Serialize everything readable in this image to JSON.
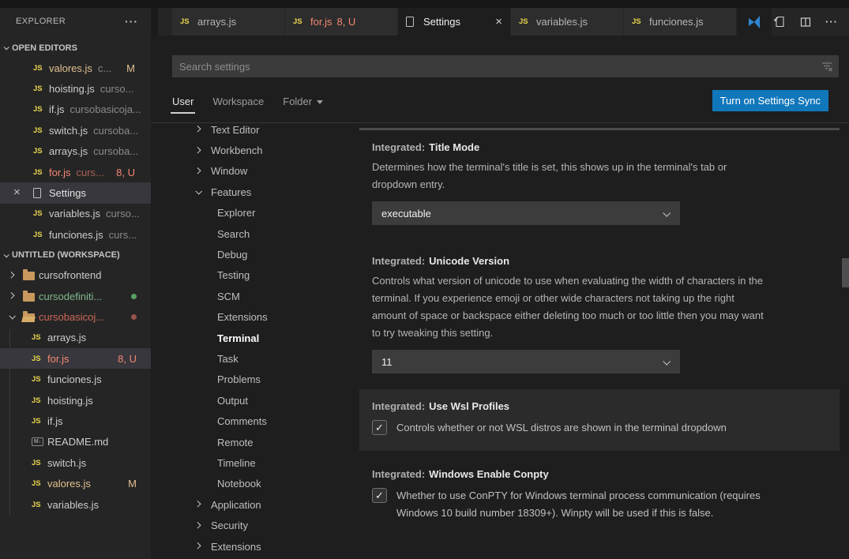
{
  "explorer": {
    "title": "EXPLORER",
    "open_editors": {
      "header": "OPEN EDITORS",
      "items": [
        {
          "icon": "js",
          "label": "valores.js",
          "suffix": "c...",
          "badge": "M",
          "badge_color": "mod",
          "color": "c-mod"
        },
        {
          "icon": "js",
          "label": "hoisting.js",
          "suffix": "curso..."
        },
        {
          "icon": "js",
          "label": "if.js",
          "suffix": "cursobasicoja..."
        },
        {
          "icon": "js",
          "label": "switch.js",
          "suffix": "cursoba..."
        },
        {
          "icon": "js",
          "label": "arrays.js",
          "suffix": "cursoba..."
        },
        {
          "icon": "js",
          "label": "for.js",
          "suffix": "curs...",
          "badge": "8, U",
          "badge_color": "err",
          "color": "c-err"
        },
        {
          "icon": "file",
          "label": "Settings",
          "selected": true,
          "close": "×"
        },
        {
          "icon": "js",
          "label": "variables.js",
          "suffix": "curso..."
        },
        {
          "icon": "js",
          "label": "funciones.js",
          "suffix": "curs..."
        }
      ]
    },
    "workspace": {
      "header": "UNTITLED (WORKSPACE)",
      "items": [
        {
          "icon": "folder",
          "chevron": "right",
          "label": "cursofrontend"
        },
        {
          "icon": "folder",
          "chevron": "right",
          "label": "cursodefiniti...",
          "color": "c-green",
          "dot": "green"
        },
        {
          "icon": "folder-open",
          "chevron": "down",
          "label": "cursobasicoj...",
          "color": "c-red",
          "dot": "red"
        },
        {
          "icon": "js",
          "label": "arrays.js",
          "child": true
        },
        {
          "icon": "js",
          "label": "for.js",
          "badge": "8, U",
          "badge_color": "err",
          "color": "c-err",
          "selected": true,
          "child": true
        },
        {
          "icon": "js",
          "label": "funciones.js",
          "child": true
        },
        {
          "icon": "js",
          "label": "hoisting.js",
          "child": true
        },
        {
          "icon": "js",
          "label": "if.js",
          "child": true
        },
        {
          "icon": "md",
          "label": "README.md",
          "child": true
        },
        {
          "icon": "js",
          "label": "switch.js",
          "child": true
        },
        {
          "icon": "js",
          "label": "valores.js",
          "badge": "M",
          "badge_color": "mod",
          "color": "c-mod",
          "child": true
        },
        {
          "icon": "js",
          "label": "variables.js",
          "child": true
        }
      ]
    }
  },
  "tabbar": {
    "tabs": [
      {
        "icon": "js",
        "label": "arrays.js"
      },
      {
        "icon": "js",
        "label": "for.js",
        "badge": "8, U",
        "err": true
      },
      {
        "icon": "file",
        "label": "Settings",
        "active": true,
        "close": "×"
      },
      {
        "icon": "js",
        "label": "variables.js"
      },
      {
        "icon": "js",
        "label": "funciones.js"
      }
    ],
    "overflow_icon": "blue-file",
    "actions": [
      "open-settings-json",
      "split-editor",
      "more"
    ]
  },
  "settings": {
    "search": {
      "placeholder": "Search settings"
    },
    "scopes": [
      {
        "label": "User",
        "active": true
      },
      {
        "label": "Workspace"
      },
      {
        "label": "Folder",
        "dropdown": true
      }
    ],
    "sync_button": "Turn on Settings Sync",
    "toc": [
      {
        "label": "Text Editor",
        "chevron": "right"
      },
      {
        "label": "Workbench",
        "chevron": "right"
      },
      {
        "label": "Window",
        "chevron": "right"
      },
      {
        "label": "Features",
        "chevron": "down"
      },
      {
        "label": "Explorer",
        "child": true
      },
      {
        "label": "Search",
        "child": true
      },
      {
        "label": "Debug",
        "child": true
      },
      {
        "label": "Testing",
        "child": true
      },
      {
        "label": "SCM",
        "child": true
      },
      {
        "label": "Extensions",
        "child": true
      },
      {
        "label": "Terminal",
        "child": true,
        "active": true
      },
      {
        "label": "Task",
        "child": true
      },
      {
        "label": "Problems",
        "child": true
      },
      {
        "label": "Output",
        "child": true
      },
      {
        "label": "Comments",
        "child": true
      },
      {
        "label": "Remote",
        "child": true
      },
      {
        "label": "Timeline",
        "child": true
      },
      {
        "label": "Notebook",
        "child": true
      },
      {
        "label": "Application",
        "chevron": "right"
      },
      {
        "label": "Security",
        "chevron": "right"
      },
      {
        "label": "Extensions",
        "chevron": "right"
      }
    ],
    "sections": [
      {
        "prefix": "Integrated:",
        "name": "Title Mode",
        "is_select": true,
        "value": "executable",
        "description": "Determines how the terminal's title is set, this shows up in the terminal's tab or dropdown entry."
      },
      {
        "prefix": "Integrated:",
        "name": "Unicode Version",
        "is_select": true,
        "value": "11",
        "description": "Controls what version of unicode to use when evaluating the width of characters in the terminal. If you experience emoji or other wide characters not taking up the right amount of space or backspace either deleting too much or too little then you may want to try tweaking this setting."
      },
      {
        "prefix": "Integrated:",
        "name": "Use Wsl Profiles",
        "is_checkbox": true,
        "checked": true,
        "highlighted": true,
        "description": "Controls whether or not WSL distros are shown in the terminal dropdown"
      },
      {
        "prefix": "Integrated:",
        "name": "Windows Enable Conpty",
        "is_checkbox": true,
        "checked": true,
        "description": "Whether to use ConPTY for Windows terminal process communication (requires Windows 10 build number 18309+). Winpty will be used if this is false."
      }
    ],
    "colors": {
      "accent": "#1177bb",
      "modified": "#e2c08d",
      "error": "#f48771",
      "git_added": "#81b88b",
      "git_conflict": "#cd6856"
    }
  }
}
